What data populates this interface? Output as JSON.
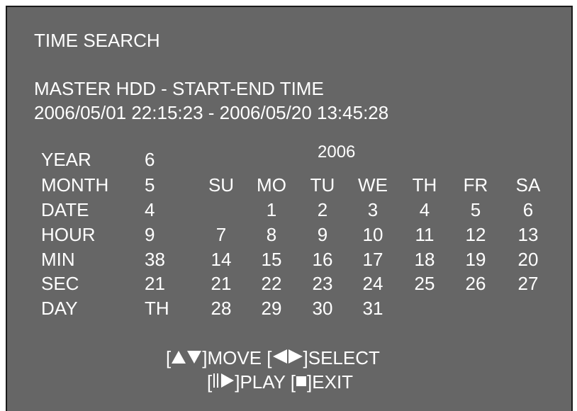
{
  "colors": {
    "background": "#666666",
    "text": "#ffffff",
    "frame": "#1a1a1a"
  },
  "title": "TIME SEARCH",
  "master": {
    "heading": "MASTER HDD - START-END TIME",
    "range": "2006/05/01 22:15:23 - 2006/05/20 13:45:28"
  },
  "fields": [
    {
      "label": "YEAR",
      "value": "6"
    },
    {
      "label": "MONTH",
      "value": "5"
    },
    {
      "label": "DATE",
      "value": "4"
    },
    {
      "label": "HOUR",
      "value": "9"
    },
    {
      "label": "MIN",
      "value": "38"
    },
    {
      "label": "SEC",
      "value": "21"
    },
    {
      "label": "DAY",
      "value": "TH"
    }
  ],
  "calendar": {
    "year": "2006",
    "weekdays": [
      "SU",
      "MO",
      "TU",
      "WE",
      "TH",
      "FR",
      "SA"
    ],
    "weeks": [
      [
        "",
        "1",
        "2",
        "3",
        "4",
        "5",
        "6"
      ],
      [
        "7",
        "8",
        "9",
        "10",
        "11",
        "12",
        "13"
      ],
      [
        "14",
        "15",
        "16",
        "17",
        "18",
        "19",
        "20"
      ],
      [
        "21",
        "22",
        "23",
        "24",
        "25",
        "26",
        "27"
      ],
      [
        "28",
        "29",
        "30",
        "31",
        "",
        "",
        ""
      ]
    ]
  },
  "help": {
    "move_label": "MOVE",
    "select_label": "SELECT",
    "play_label": "PLAY",
    "exit_label": "EXIT",
    "icons": [
      "up-triangle-icon",
      "down-triangle-icon",
      "left-triangle-icon",
      "right-triangle-icon",
      "pause-icon",
      "play-icon",
      "stop-icon"
    ]
  }
}
